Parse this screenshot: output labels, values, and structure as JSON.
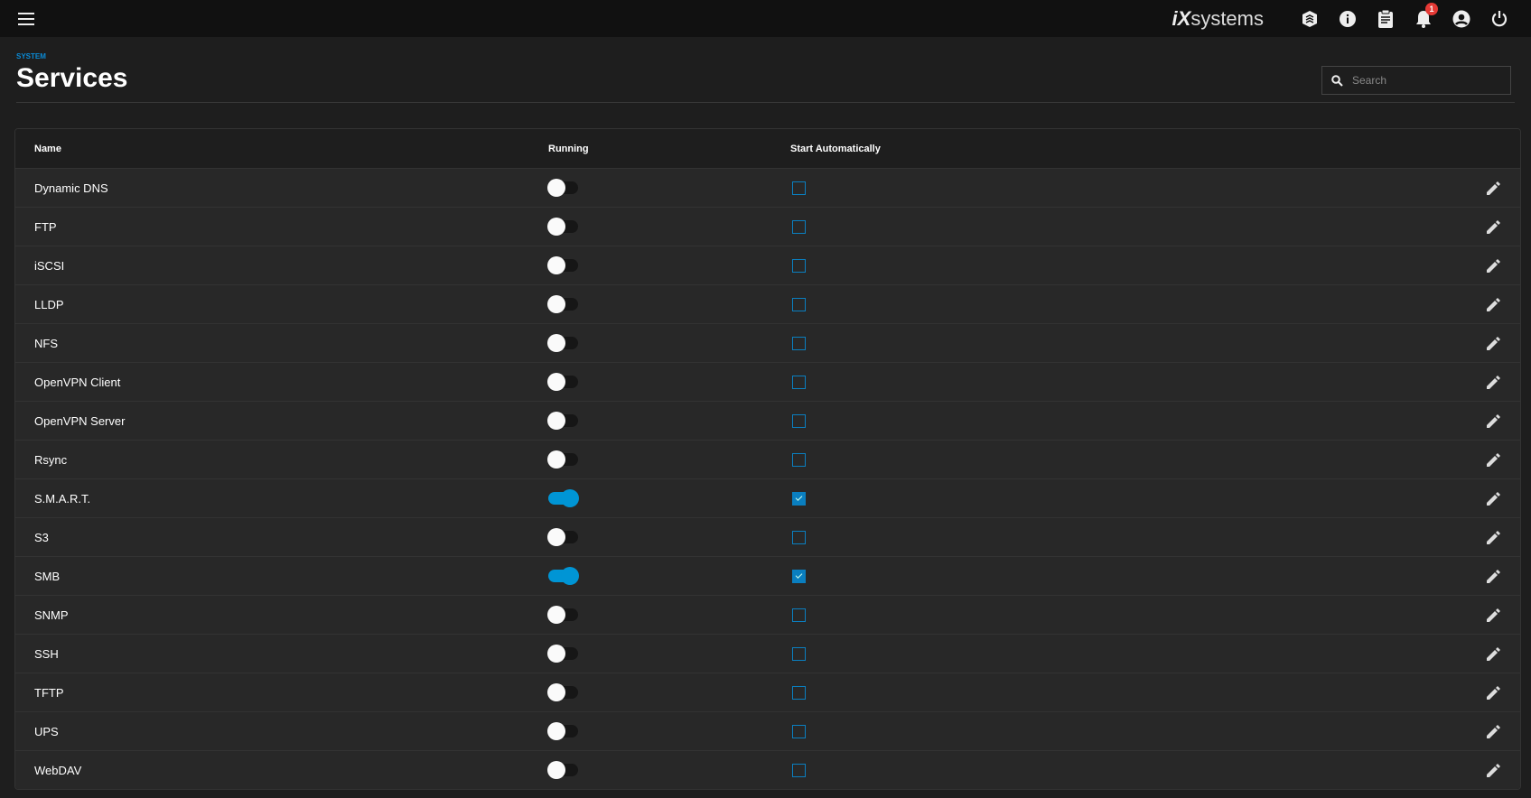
{
  "topbar": {
    "brand": "iX",
    "brand_rest": "systems",
    "notification_count": "1"
  },
  "page": {
    "breadcrumb": "SYSTEM",
    "title": "Services",
    "search_placeholder": "Search"
  },
  "table": {
    "headers": {
      "name": "Name",
      "running": "Running",
      "start_auto": "Start Automatically"
    },
    "rows": [
      {
        "name": "Dynamic DNS",
        "running": false,
        "auto": false
      },
      {
        "name": "FTP",
        "running": false,
        "auto": false
      },
      {
        "name": "iSCSI",
        "running": false,
        "auto": false
      },
      {
        "name": "LLDP",
        "running": false,
        "auto": false
      },
      {
        "name": "NFS",
        "running": false,
        "auto": false
      },
      {
        "name": "OpenVPN Client",
        "running": false,
        "auto": false
      },
      {
        "name": "OpenVPN Server",
        "running": false,
        "auto": false
      },
      {
        "name": "Rsync",
        "running": false,
        "auto": false
      },
      {
        "name": "S.M.A.R.T.",
        "running": true,
        "auto": true
      },
      {
        "name": "S3",
        "running": false,
        "auto": false
      },
      {
        "name": "SMB",
        "running": true,
        "auto": true
      },
      {
        "name": "SNMP",
        "running": false,
        "auto": false
      },
      {
        "name": "SSH",
        "running": false,
        "auto": false
      },
      {
        "name": "TFTP",
        "running": false,
        "auto": false
      },
      {
        "name": "UPS",
        "running": false,
        "auto": false
      },
      {
        "name": "WebDAV",
        "running": false,
        "auto": false
      }
    ]
  },
  "colors": {
    "accent": "#0095d5",
    "topbar": "#111111",
    "row": "#282828"
  }
}
